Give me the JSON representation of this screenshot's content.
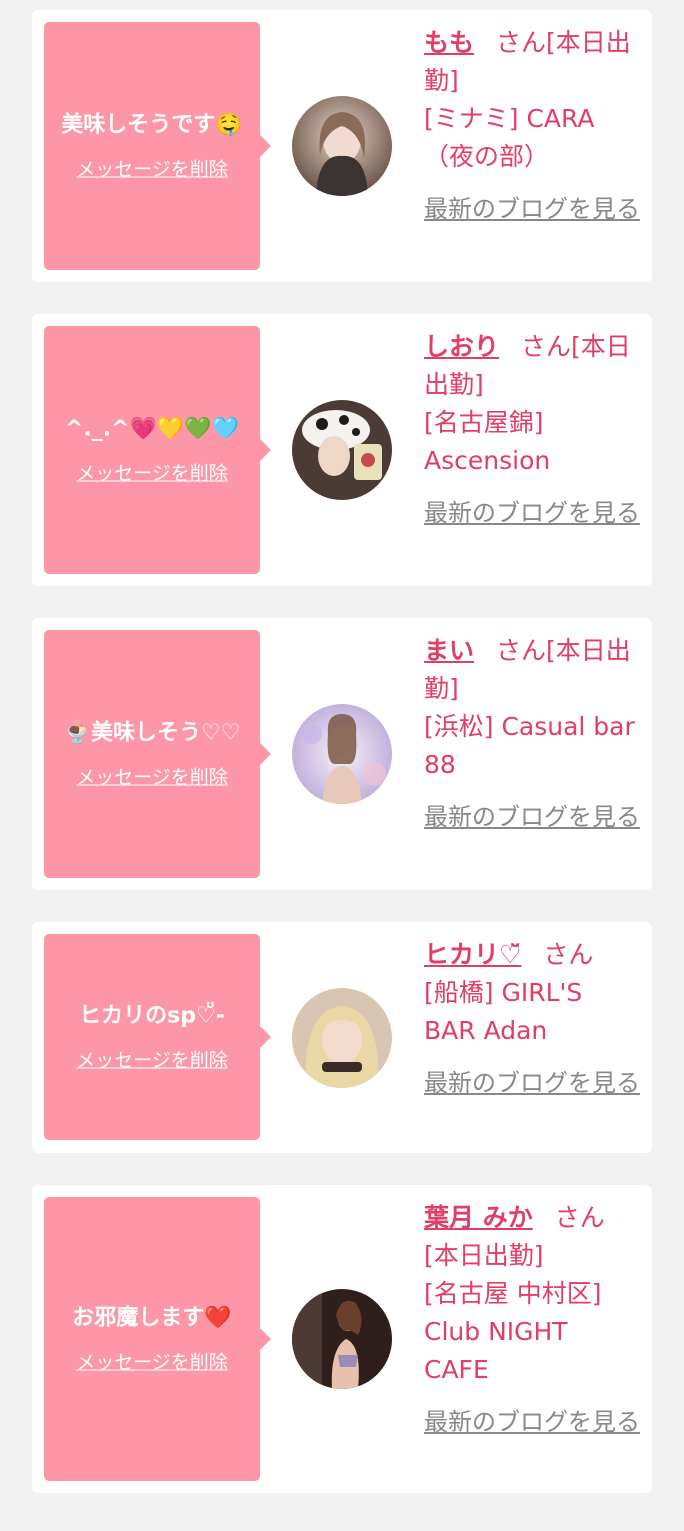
{
  "delete_label": "メッセージを削除",
  "blog_label": "最新のブログを見る",
  "san_label": "さん",
  "colors": {
    "accent": "#e23d67",
    "bubble": "#fd97a8",
    "background": "#f1f1f1",
    "muted": "#888888"
  },
  "cards": [
    {
      "message": "美味しそうです🤤",
      "name": "もも",
      "detail": "[本日出勤]",
      "shop": "[ミナミ] CARA（夜の部）",
      "avatar_icon": "avatar-photo-icon"
    },
    {
      "message": "^._.^💗💛💚🩵",
      "name": "しおり",
      "detail": "[本日出勤]",
      "shop": "[名古屋錦] Ascension",
      "avatar_icon": "avatar-photo-icon"
    },
    {
      "message": "🍨美味しそう♡♡",
      "name": "まい",
      "detail": "[本日出勤]",
      "shop": "[浜松] Casual bar 88",
      "avatar_icon": "avatar-photo-icon"
    },
    {
      "message": "ヒカリのsp♡̆̈-",
      "name": "ヒカリ♡̆̈",
      "detail": "",
      "shop": "[船橋] GIRL'S BAR Adan",
      "avatar_icon": "avatar-photo-icon"
    },
    {
      "message": "お邪魔します❤️",
      "name": "葉月 みか",
      "detail": "[本日出勤]",
      "shop": "[名古屋 中村区] Club NIGHT CAFE",
      "avatar_icon": "avatar-photo-icon"
    }
  ]
}
